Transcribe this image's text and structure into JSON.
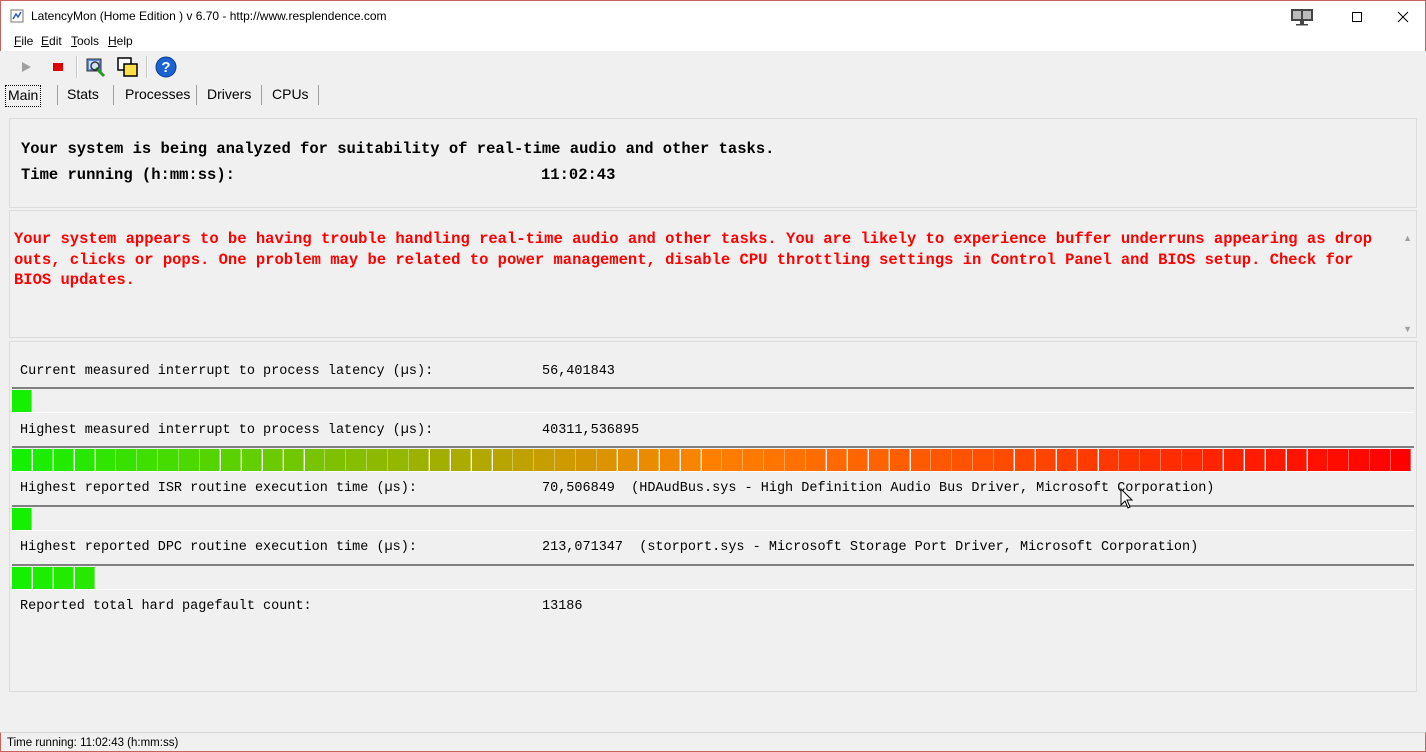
{
  "window": {
    "title": "LatencyMon  (Home Edition )  v 6.70 - http://www.resplendence.com",
    "minimize_glyph": "—",
    "maximize_glyph": "☐",
    "close_glyph": "✕"
  },
  "menu": [
    {
      "key": "F",
      "rest": "ile"
    },
    {
      "key": "E",
      "rest": "dit"
    },
    {
      "key": "T",
      "rest": "ools"
    },
    {
      "key": "H",
      "rest": "elp"
    }
  ],
  "toolbar": {
    "icons": [
      "play-icon",
      "stop-icon",
      "analyze-icon",
      "windows-icon",
      "help-icon"
    ],
    "colors": {
      "stop": "#e00000",
      "help": "#1a63d0",
      "play": "#a0a0a0"
    }
  },
  "tabs": [
    {
      "label": "Main",
      "active": true
    },
    {
      "label": "Stats",
      "active": false
    },
    {
      "label": "Processes",
      "active": false
    },
    {
      "label": "Drivers",
      "active": false
    },
    {
      "label": "CPUs",
      "active": false
    }
  ],
  "status": {
    "line1": "Your system is being analyzed for suitability of real-time audio and other tasks.",
    "time_label": "Time running (h:mm:ss):",
    "time_value": "11:02:43"
  },
  "warning": {
    "text": "Your system appears to be having trouble handling real-time audio and other tasks. You are likely to experience buffer underruns appearing as drop outs, clicks or pops. One problem may be related to power management, disable CPU throttling settings in Control Panel and BIOS setup. Check for BIOS updates.",
    "color": "#ff0000"
  },
  "metrics": [
    {
      "label": "Current measured interrupt to process latency (µs):",
      "value": "56,401843",
      "meter_segments": 1
    },
    {
      "label": "Highest measured interrupt to process latency (µs):",
      "value": "40311,536895",
      "meter_segments": 67
    },
    {
      "label": "Highest reported ISR routine execution time (µs):",
      "value": "70,506849  (HDAudBus.sys - High Definition Audio Bus Driver, Microsoft Corporation)",
      "meter_segments": 1
    },
    {
      "label": "Highest reported DPC routine execution time (µs):",
      "value": "213,071347  (storport.sys - Microsoft Storage Port Driver, Microsoft Corporation)",
      "meter_segments": 4
    },
    {
      "label": "Reported total hard pagefault count:",
      "value": "13186"
    }
  ],
  "meter_total_segments": 67,
  "statusbar": {
    "text": "Time running: 11:02:43  (h:mm:ss)"
  }
}
